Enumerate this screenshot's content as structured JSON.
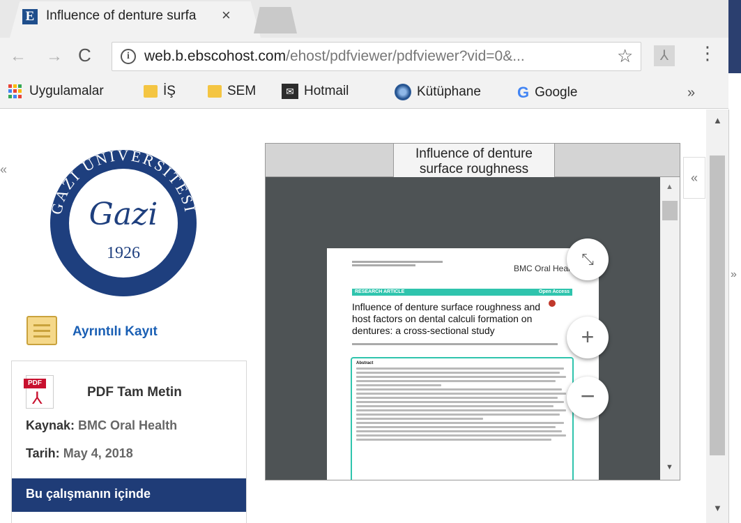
{
  "browser": {
    "tab": {
      "favicon_letter": "E",
      "title": "Influence of denture surfa",
      "close": "×"
    },
    "nav": {
      "back": "←",
      "forward": "→",
      "reload": "C"
    },
    "url": {
      "host": "web.b.ebscohost.com",
      "path": "/ehost/pdfviewer/pdfviewer?vid=0&..."
    },
    "star": "☆",
    "menu": "⋮",
    "bookmarks": [
      {
        "label": "Uygulamalar"
      },
      {
        "label": "İŞ"
      },
      {
        "label": "SEM"
      },
      {
        "label": "Hotmail"
      },
      {
        "label": "Kütüphane"
      },
      {
        "label": "Google"
      }
    ],
    "bookmarks_more": "»"
  },
  "sidebar": {
    "collapse": "«",
    "logo": {
      "text": "GAZİ ÜNİVERSİTESİ",
      "signature": "Gazi",
      "year": "1926"
    },
    "detail_link": "Ayrıntılı Kayıt",
    "pdf_link": "PDF Tam Metin",
    "pdf_tag": "PDF",
    "source_label": "Kaynak:",
    "source_value": "BMC Oral Health",
    "date_label": "Tarih:",
    "date_value": "May 4, 2018",
    "in_study": "Bu çalışmanın içinde"
  },
  "viewer": {
    "title": "Influence of denture surface roughness",
    "collapse": "«",
    "zoom_fit": "⤡",
    "zoom_in": "+",
    "zoom_out": "−"
  },
  "paper": {
    "journal": "BMC Oral Health",
    "band_left": "RESEARCH ARTICLE",
    "band_right": "Open Access",
    "title": "Influence of denture surface roughness and host factors on dental calculi formation on dentures: a cross-sectional study",
    "abstract_heading": "Abstract"
  },
  "colors": {
    "accent": "#1f3c77",
    "link": "#1a5fb4",
    "teal": "#2fc4ad"
  }
}
